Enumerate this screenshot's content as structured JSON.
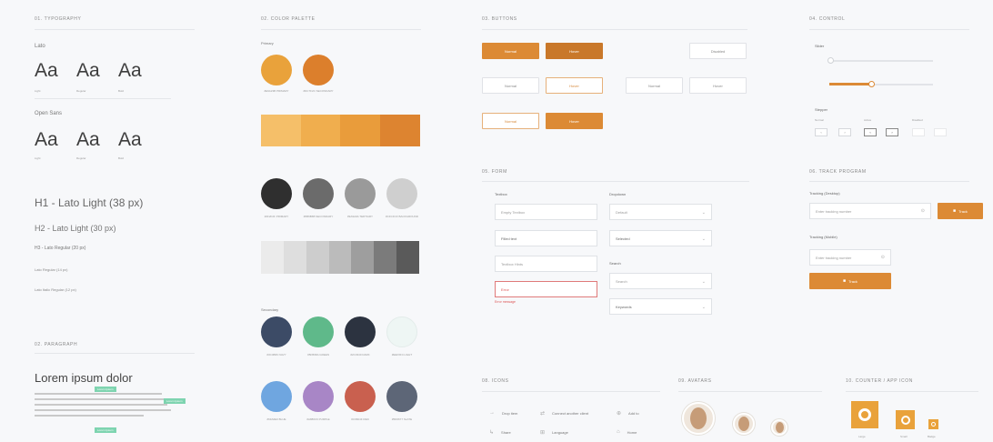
{
  "sections": {
    "typo": "01. TYPOGRAPHY",
    "colors": "02. COLOR PALETTE",
    "buttons": "03. BUTTONS",
    "controls": "04. CONTROL",
    "form": "05. FORM",
    "tracking": "06. TRACK PROGRAM",
    "paragraph": "02. PARAGRAPH",
    "icons": "08. ICONS",
    "avatars": "09. AVATARS",
    "counter": "10. COUNTER / APP ICON"
  },
  "typography": {
    "font1": "Lato",
    "font2": "Open Sans",
    "sample": "Aa",
    "weights1": [
      "Light",
      "Regular",
      "Bold"
    ],
    "weights2": [
      "Light",
      "Regular",
      "Bold"
    ],
    "h1": "H1 - Lato Light (38 px)",
    "h2": "H2 - Lato Light (30 px)",
    "h3": "H3 - Lato Regular (20 px)",
    "body": "Lato Regular (14 px)",
    "small": "Lato Italic Regular (12 px)"
  },
  "paragraph": {
    "heading": "Lorem ipsum dolor",
    "tag": "Lorem Ipsum"
  },
  "palette": {
    "primary_label": "Primary",
    "secondary_label": "Secondary",
    "primary": [
      {
        "hex": "#e9a23b",
        "label": "#E9A23B PRIMARY"
      },
      {
        "hex": "#dc7f2c",
        "label": "#DC7F2C SECONDARY"
      }
    ],
    "primary_strip": [
      "#f5bf69",
      "#f0ae4e",
      "#e99c3b",
      "#dd8430"
    ],
    "greys": [
      {
        "hex": "#2f2f2f",
        "label": "#2F2F2F PRIMARY"
      },
      {
        "hex": "#6b6b6b",
        "label": "#6B6B6B SECONDARY"
      },
      {
        "hex": "#9a9a9a",
        "label": "#9A9A9A TERTIARY"
      },
      {
        "hex": "#cfcfcf",
        "label": "#CFCFCF BACKGROUND"
      }
    ],
    "grey_strip": [
      "#ebebeb",
      "#dedede",
      "#cdcdcd",
      "#bbbbbb",
      "#9e9e9e",
      "#7b7b7b",
      "#5a5a5a"
    ],
    "secondary": [
      {
        "hex": "#3c4b66",
        "label": "#3C4B66 NAVY"
      },
      {
        "hex": "#5fb98a",
        "label": "#5FB98A GREEN"
      },
      {
        "hex": "#2c3340",
        "label": "#2C3340 DARK"
      },
      {
        "hex": "#eef6f4",
        "label": "#EEF6F4 LIGHT"
      },
      {
        "hex": "#6fa6e0",
        "label": "#6FA6E0 BLUE"
      },
      {
        "hex": "#a886c6",
        "label": "#A886C6 PURPLE"
      },
      {
        "hex": "#c9604f",
        "label": "#C9604F RED"
      },
      {
        "hex": "#5d6677",
        "label": "#5D6677 SLATE"
      }
    ]
  },
  "buttons": {
    "normal": "Normal",
    "hover": "Hover",
    "disabled": "Disabled"
  },
  "controls": {
    "slider_label": "Slider",
    "stepper_label": "Stepper",
    "normal": "Normal",
    "active": "Active",
    "disabled": "Disabled",
    "slider_value": 0.4
  },
  "form": {
    "textbox_label": "Textbox",
    "dropdown_label": "Dropdown",
    "search_label": "Search",
    "ph1": "Empty Textbox",
    "ph2": "Filled text",
    "ph3": "Textbox Hints",
    "ph4": "Error",
    "error_msg": "Error message",
    "dd1": "Default",
    "dd2": "Selected",
    "dd3": "Search",
    "dd4": "Keywords"
  },
  "tracking": {
    "label1": "Tracking (Desktop)",
    "label2": "Tracking (Mobile)",
    "placeholder": "Enter tracking number",
    "button": "Track"
  },
  "icons": {
    "items": [
      {
        "glyph": "→",
        "label": "Drop item"
      },
      {
        "glyph": "⇄",
        "label": "Connect another client"
      },
      {
        "glyph": "⊕",
        "label": "Add to"
      },
      {
        "glyph": "↳",
        "label": "Share"
      },
      {
        "glyph": "⊞",
        "label": "Language"
      },
      {
        "glyph": "⌂",
        "label": "Home"
      }
    ]
  },
  "counter": {
    "labels": [
      "Large",
      "Small",
      "Badge"
    ]
  }
}
